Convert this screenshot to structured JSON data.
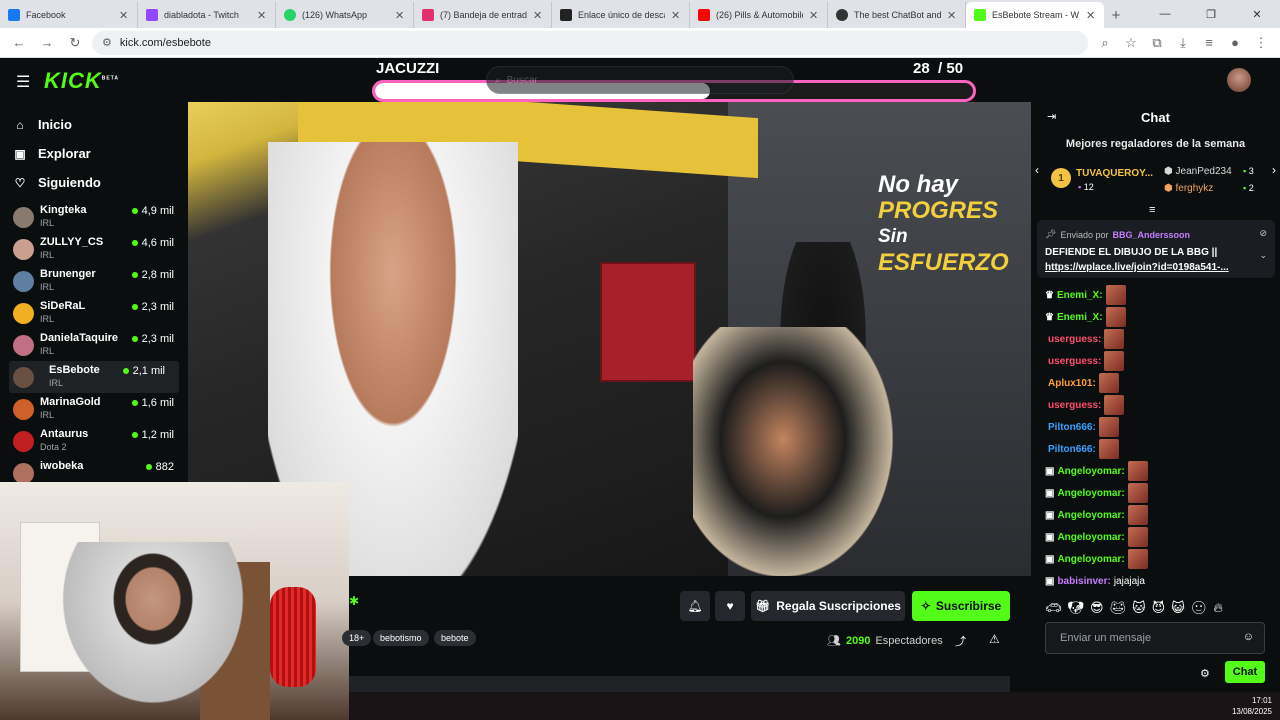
{
  "browser": {
    "tabs": [
      {
        "label": "Facebook",
        "color": "#1877f2"
      },
      {
        "label": "diabladota - Twitch",
        "color": "#9146ff"
      },
      {
        "label": "(126) WhatsApp",
        "color": "#25d366"
      },
      {
        "label": "(7) Bandeja de entrada - •",
        "color": "#e1306c"
      },
      {
        "label": "Enlace único de descarga",
        "color": "#222222"
      },
      {
        "label": "(26) Pills & Automobiles",
        "color": "#ff0000"
      },
      {
        "label": "The best ChatBot and W",
        "color": "#333333"
      },
      {
        "label": "EsBebote Stream - W",
        "color": "#53fc18"
      }
    ],
    "url": "kick.com/esbebote"
  },
  "header": {
    "logo": "KICK",
    "logo_beta": "BETA",
    "search_placeholder": "Buscar"
  },
  "overlay": {
    "goal_title": "JACUZZI",
    "goal_current": "28",
    "goal_total": "/ 50",
    "goal_progress": 0.56
  },
  "sidebar": {
    "nav": [
      {
        "label": "Inicio",
        "icon": "home-icon"
      },
      {
        "label": "Explorar",
        "icon": "explore-icon"
      },
      {
        "label": "Siguiendo",
        "icon": "heart-icon"
      }
    ],
    "channels": [
      {
        "name": "Kingteka",
        "category": "IRL",
        "viewers": "4,9 mil",
        "color": "#8a7a6e"
      },
      {
        "name": "ZULLYY_CS",
        "category": "IRL",
        "viewers": "4,6 mil",
        "color": "#c9a090"
      },
      {
        "name": "Brunenger",
        "category": "IRL",
        "viewers": "2,8 mil",
        "color": "#5f7fa0"
      },
      {
        "name": "SiDeRaL",
        "category": "IRL",
        "viewers": "2,3 mil",
        "color": "#f0b020"
      },
      {
        "name": "DanielaTaquire",
        "category": "IRL",
        "viewers": "2,3 mil",
        "color": "#c07080"
      },
      {
        "name": "EsBebote",
        "category": "IRL",
        "viewers": "2,1 mil",
        "color": "#6a5040"
      },
      {
        "name": "MarinaGold",
        "category": "IRL",
        "viewers": "1,6 mil",
        "color": "#d0602a"
      },
      {
        "name": "Antaurus",
        "category": "Dota 2",
        "viewers": "1,2 mil",
        "color": "#c02020"
      },
      {
        "name": "iwobeka",
        "category": "",
        "viewers": "882",
        "color": "#b07060"
      }
    ]
  },
  "video": {
    "wall_text": [
      "No hay",
      "PROGRES",
      "Sin",
      "ESFUERZO"
    ]
  },
  "stream_info": {
    "gift_label": "Regala Suscripciones",
    "subscribe_label": "Suscribirse",
    "tags": [
      "18+",
      "bebotismo",
      "bebote"
    ],
    "viewers_count": "2090",
    "viewers_label": "Espectadores"
  },
  "chat": {
    "title": "Chat",
    "gifters_title": "Mejores regaladores de la semana",
    "gifters": [
      {
        "rank": "1",
        "name": "TUVAQUEROY...",
        "count": "12"
      },
      {
        "name": "JeanPed234",
        "count": "3"
      },
      {
        "name": "ferghykz",
        "count": "2"
      }
    ],
    "pinned": {
      "sent_by_label": "Enviado por",
      "user": "BBG_Anderssoon",
      "message": "DEFIENDE EL DIBUJO DE LA BBG ||",
      "link": "https://wplace.live/join?id=0198a541-..."
    },
    "messages": [
      {
        "user": "Enemi_X:",
        "color": "#53fc18",
        "text": ""
      },
      {
        "user": "Enemi_X:",
        "color": "#53fc18",
        "text": ""
      },
      {
        "user": "userguess:",
        "color": "#ff4d6d",
        "text": ""
      },
      {
        "user": "userguess:",
        "color": "#ff4d6d",
        "text": ""
      },
      {
        "user": "Aplux101:",
        "color": "#ff9f3a",
        "text": ""
      },
      {
        "user": "userguess:",
        "color": "#ff4d6d",
        "text": ""
      },
      {
        "user": "Pilton666:",
        "color": "#3aa0ff",
        "text": ""
      },
      {
        "user": "Pilton666:",
        "color": "#3aa0ff",
        "text": ""
      },
      {
        "user": "Angeloyomar:",
        "color": "#53fc18",
        "text": ""
      },
      {
        "user": "Angeloyomar:",
        "color": "#53fc18",
        "text": ""
      },
      {
        "user": "Angeloyomar:",
        "color": "#53fc18",
        "text": ""
      },
      {
        "user": "Angeloyomar:",
        "color": "#53fc18",
        "text": ""
      },
      {
        "user": "Angeloyomar:",
        "color": "#53fc18",
        "text": ""
      },
      {
        "user": "babisinver:",
        "color": "#c77dff",
        "text": "jajajaja"
      }
    ],
    "input_placeholder": "Enviar un mensaje",
    "send_label": "Chat"
  },
  "taskbar": {
    "time": "17:01",
    "date": "13/08/2025"
  }
}
